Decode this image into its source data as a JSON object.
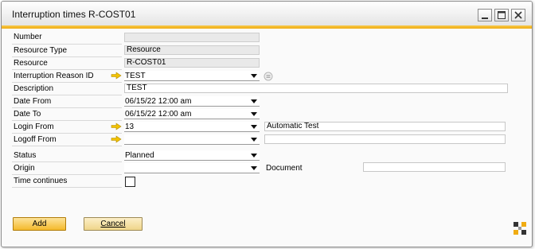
{
  "window": {
    "title": "Interruption times R-COST01"
  },
  "form": {
    "number": {
      "label": "Number",
      "value": ""
    },
    "resource_type": {
      "label": "Resource Type",
      "value": "Resource"
    },
    "resource": {
      "label": "Resource",
      "value": "R-COST01"
    },
    "interruption_reason": {
      "label": "Interruption Reason ID",
      "value": "TEST"
    },
    "description": {
      "label": "Description",
      "value": "TEST"
    },
    "date_from": {
      "label": "Date From",
      "value": "06/15/22  12:00 am"
    },
    "date_to": {
      "label": "Date To",
      "value": "06/15/22  12:00 am"
    },
    "login_from": {
      "label": "Login From",
      "value": "13",
      "name": "Automatic Test"
    },
    "logoff_from": {
      "label": "Logoff From",
      "value": "",
      "name": ""
    },
    "status": {
      "label": "Status",
      "value": "Planned"
    },
    "origin": {
      "label": "Origin",
      "value": ""
    },
    "document": {
      "label": "Document",
      "value": ""
    },
    "time_continues": {
      "label": "Time continues",
      "checked": false
    }
  },
  "buttons": {
    "add": "Add",
    "cancel": "Cancel"
  },
  "colors": {
    "accent": "#f0ac12",
    "link_arrow": "#f2c200"
  }
}
